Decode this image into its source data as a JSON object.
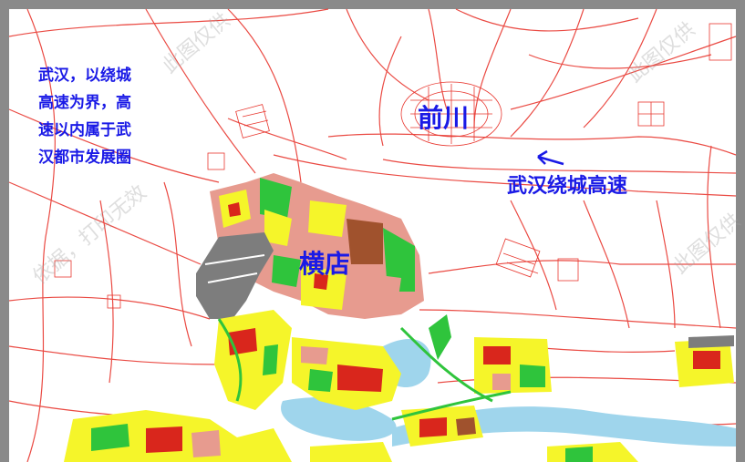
{
  "annotations": {
    "note": "武汉，以绕城\n高速为界，高\n速以内属于武\n汉都市发展圈",
    "qianchuan": "前川",
    "hengdian": "横店",
    "ring_road": "武汉绕城高速"
  },
  "watermarks": [
    "此图仅供",
    "依据，打印无效",
    "此图仅供",
    "此图仅供"
  ],
  "colors": {
    "label_blue": "#1a1ae6",
    "road_red": "#e8372f",
    "residential_yellow": "#f5f52a",
    "commercial_red": "#d9261c",
    "green_space": "#2fc43c",
    "industrial_brown": "#a0522d",
    "pink_landuse": "#e79b8f",
    "airport_gray": "#7d7d7d",
    "water_blue": "#9fd5ec"
  },
  "icons": [
    "arrow-icon"
  ]
}
